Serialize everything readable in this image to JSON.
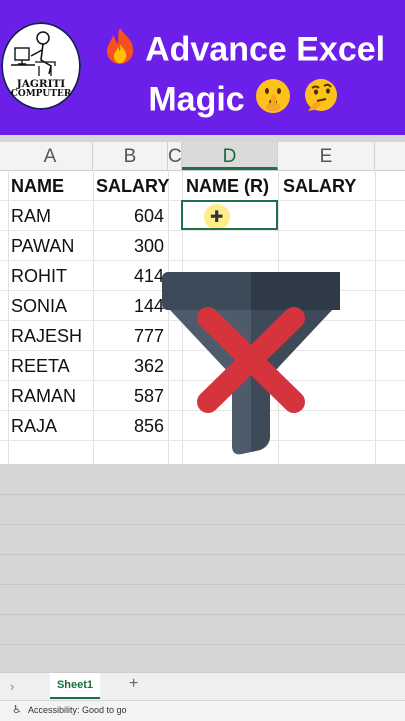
{
  "banner": {
    "logo_line1": "JAGRITI",
    "logo_line2": "COMPUTER",
    "title_line1": "Advance Excel",
    "title_line2": "Magic",
    "background": "#6c1fe8",
    "icons": [
      "fire-emoji-icon",
      "shushing-face-emoji-icon",
      "thinking-face-emoji-icon"
    ]
  },
  "sheet": {
    "columns": [
      "A",
      "B",
      "C",
      "D",
      "E"
    ],
    "active_column": "D",
    "headers": {
      "a": "NAME",
      "b": "SALARY",
      "d": "NAME (R)",
      "e": "SALARY"
    },
    "rows": [
      {
        "name": "RAM",
        "salary": "604"
      },
      {
        "name": "PAWAN",
        "salary": "300"
      },
      {
        "name": "ROHIT",
        "salary": "414"
      },
      {
        "name": "SONIA",
        "salary": "144"
      },
      {
        "name": "RAJESH",
        "salary": "777"
      },
      {
        "name": "REETA",
        "salary": "362"
      },
      {
        "name": "RAMAN",
        "salary": "587"
      },
      {
        "name": "RAJA",
        "salary": "856"
      }
    ],
    "selected_cell": "D2"
  },
  "overlay": {
    "icon": "no-filter-icon",
    "funnel_color": "#3c4a5a",
    "cross_color": "#d6343c"
  },
  "tabs": {
    "sheet_name": "Sheet1",
    "add_label": "+"
  },
  "status": {
    "accessibility": "Accessibility: Good to go"
  }
}
